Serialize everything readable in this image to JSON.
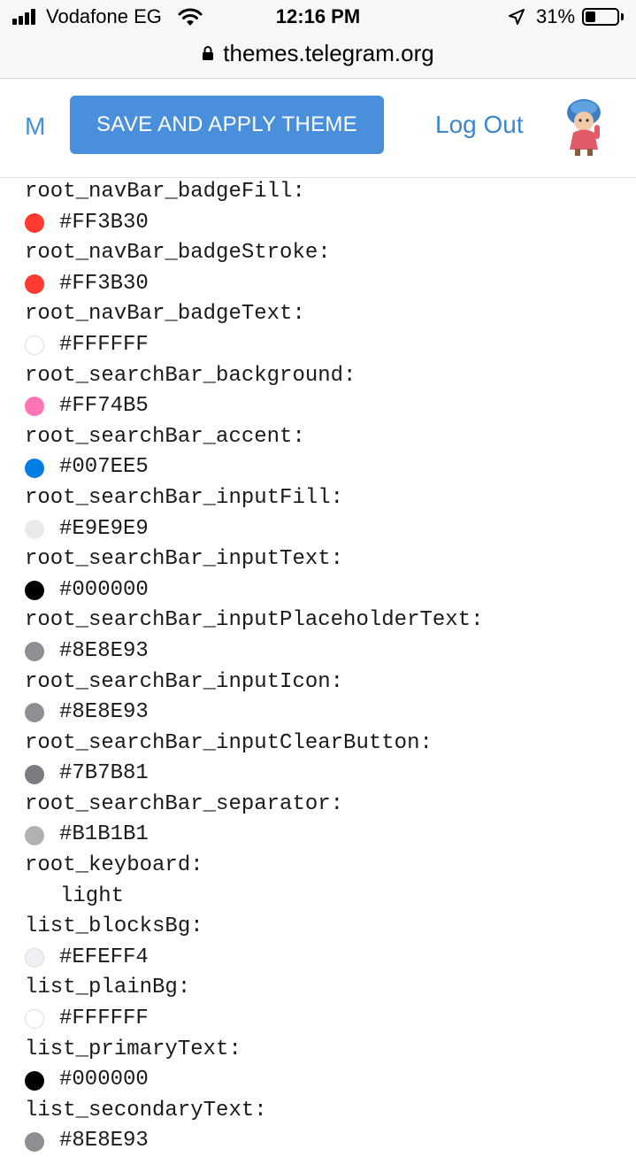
{
  "status_bar": {
    "carrier": "Vodafone EG",
    "time": "12:16 PM",
    "battery_percent": "31%",
    "battery_level": 0.31,
    "icons": [
      "signal-icon",
      "wifi-icon",
      "location-icon",
      "battery-icon"
    ]
  },
  "browser": {
    "url": "themes.telegram.org",
    "icons": [
      "lock-icon"
    ]
  },
  "header": {
    "nav_partial": "M",
    "save_button": "SAVE AND APPLY THEME",
    "logout": "Log Out",
    "accent_color": "#4A8FDC"
  },
  "entries": [
    {
      "key": "root_navBar_badgeFill:",
      "value": "#FF3B30",
      "swatch": "#FF3B30"
    },
    {
      "key": "root_navBar_badgeStroke:",
      "value": "#FF3B30",
      "swatch": "#FF3B30"
    },
    {
      "key": "root_navBar_badgeText:",
      "value": "#FFFFFF",
      "swatch": "#FFFFFF"
    },
    {
      "key": "root_searchBar_background:",
      "value": "#FF74B5",
      "swatch": "#FF74B5"
    },
    {
      "key": "root_searchBar_accent:",
      "value": "#007EE5",
      "swatch": "#007EE5"
    },
    {
      "key": "root_searchBar_inputFill:",
      "value": "#E9E9E9",
      "swatch": "#E9E9E9"
    },
    {
      "key": "root_searchBar_inputText:",
      "value": "#000000",
      "swatch": "#000000"
    },
    {
      "key": "root_searchBar_inputPlaceholderText:",
      "value": "#8E8E93",
      "swatch": "#8E8E93"
    },
    {
      "key": "root_searchBar_inputIcon:",
      "value": "#8E8E93",
      "swatch": "#8E8E93"
    },
    {
      "key": "root_searchBar_inputClearButton:",
      "value": "#7B7B81",
      "swatch": "#7B7B81"
    },
    {
      "key": "root_searchBar_separator:",
      "value": "#B1B1B1",
      "swatch": "#B1B1B1"
    },
    {
      "key": "root_keyboard:",
      "value": "light",
      "swatch": null
    },
    {
      "key": "list_blocksBg:",
      "value": "#EFEFF4",
      "swatch": "#EFEFF4"
    },
    {
      "key": "list_plainBg:",
      "value": "#FFFFFF",
      "swatch": "#FFFFFF"
    },
    {
      "key": "list_primaryText:",
      "value": "#000000",
      "swatch": "#000000"
    },
    {
      "key": "list_secondaryText:",
      "value": "#8E8E93",
      "swatch": "#8E8E93"
    }
  ]
}
